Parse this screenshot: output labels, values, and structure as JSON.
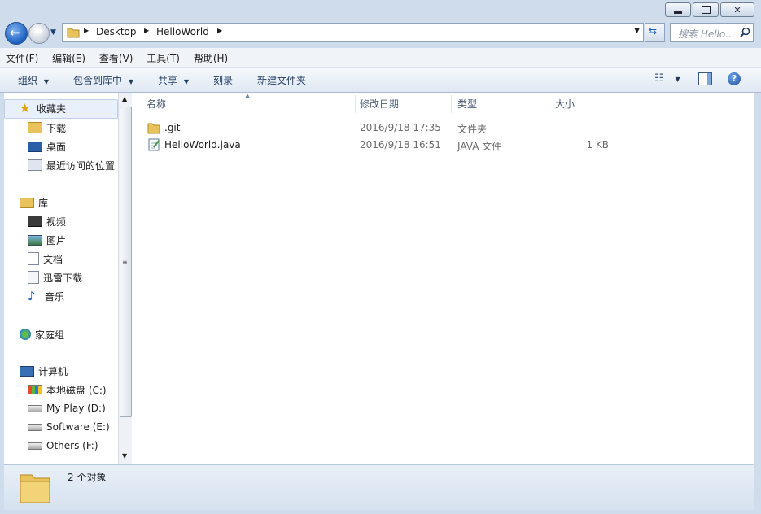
{
  "window": {
    "min": "—",
    "max": "▢",
    "close": "✕"
  },
  "nav": {
    "breadcrumb": [
      "Desktop",
      "HelloWorld"
    ],
    "search_placeholder": "搜索 Hello..."
  },
  "menu": [
    "文件(F)",
    "编辑(E)",
    "查看(V)",
    "工具(T)",
    "帮助(H)"
  ],
  "toolbar": {
    "organize": "组织",
    "include": "包含到库中",
    "share": "共享",
    "burn": "刻录",
    "new_folder": "新建文件夹"
  },
  "sidebar": {
    "favorites": {
      "label": "收藏夹",
      "items": [
        "下载",
        "桌面",
        "最近访问的位置"
      ]
    },
    "libraries": {
      "label": "库",
      "items": [
        "视频",
        "图片",
        "文档",
        "迅雷下载",
        "音乐"
      ]
    },
    "homegroup": "家庭组",
    "computer": {
      "label": "计算机",
      "items": [
        "本地磁盘 (C:)",
        "My Play (D:)",
        "Software (E:)",
        "Others (F:)"
      ]
    }
  },
  "columns": {
    "name": "名称",
    "date": "修改日期",
    "type": "类型",
    "size": "大小"
  },
  "files": [
    {
      "name": ".git",
      "date": "2016/9/18 17:35",
      "type": "文件夹",
      "size": ""
    },
    {
      "name": "HelloWorld.java",
      "date": "2016/9/18 16:51",
      "type": "JAVA 文件",
      "size": "1 KB"
    }
  ],
  "status": "2 个对象",
  "colors": {
    "accent": "#1b5fc2",
    "folder": "#e8c25a"
  }
}
